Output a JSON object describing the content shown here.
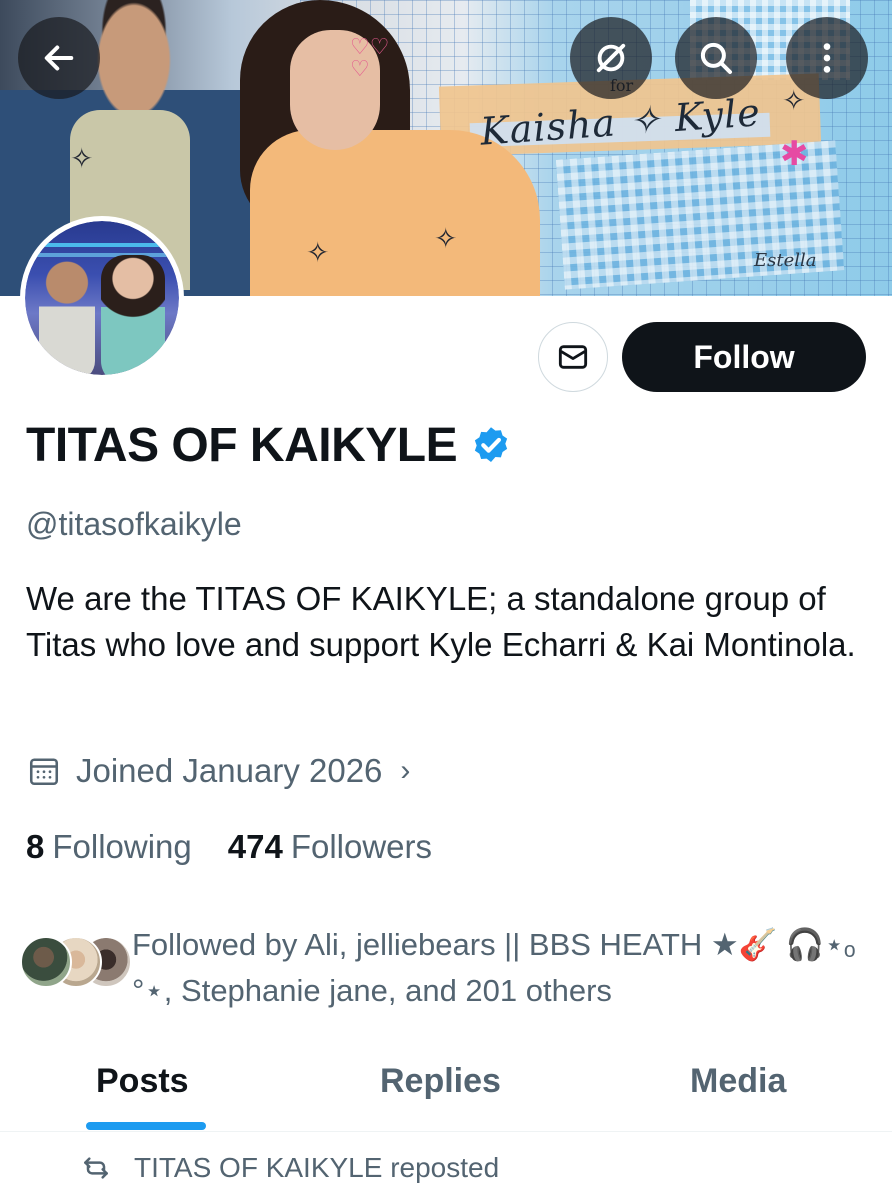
{
  "header": {
    "back_icon": "arrow-left-icon",
    "grok_icon": "grok-icon",
    "search_icon": "search-icon",
    "more_icon": "more-vertical-icon"
  },
  "banner": {
    "script_text": "Kaisha ✧ Kyle",
    "script_for": "for",
    "signature": "Estella"
  },
  "actions": {
    "message_icon": "envelope-icon",
    "follow_label": "Follow"
  },
  "profile": {
    "display_name": "TITAS OF KAIKYLE",
    "verified_icon": "verified-badge-icon",
    "handle": "@titasofkaikyle",
    "bio": "We are the TITAS OF KAIKYLE; a standalone group of Titas who love and support Kyle Echarri & Kai Montinola.",
    "joined_icon": "calendar-icon",
    "joined": "Joined January 2026",
    "joined_chevron": "›",
    "following_count": "8",
    "following_label": "Following",
    "followers_count": "474",
    "followers_label": "Followers",
    "followed_by": "Followed by Ali, jelliebears || BBS HEATH ★🎸 🎧⋆ₒ °⋆, Stephanie jane, and 201 others"
  },
  "tabs": [
    {
      "label": "Posts",
      "active": true
    },
    {
      "label": "Replies",
      "active": false
    },
    {
      "label": "Media",
      "active": false
    }
  ],
  "feed": {
    "repost_icon": "repost-icon",
    "repost_text": "TITAS OF KAIKYLE reposted"
  },
  "colors": {
    "accent": "#1d9bf0",
    "text_primary": "#0f1419",
    "text_secondary": "#536471",
    "follow_button_bg": "#0f1419"
  }
}
